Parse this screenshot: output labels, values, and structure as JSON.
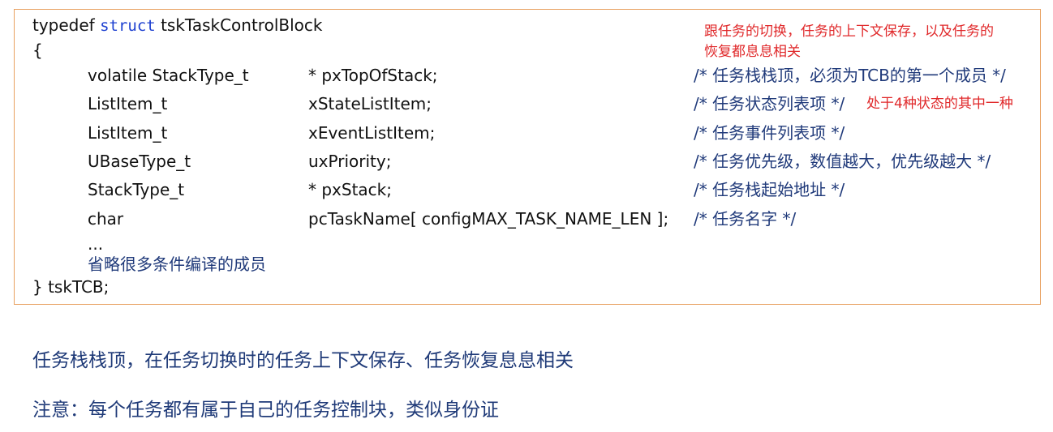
{
  "code": {
    "typedef_prefix": "typedef ",
    "keyword": "struct",
    "struct_name": " tskTaskControlBlock",
    "open_brace": "{",
    "members": [
      {
        "type": "volatile StackType_t",
        "name": "* pxTopOfStack;",
        "comment": "/* 任务栈栈顶，必须为TCB的第一个成员 */"
      },
      {
        "type": "ListItem_t",
        "name": "xStateListItem;",
        "comment": "/* 任务状态列表项 */"
      },
      {
        "type": "ListItem_t",
        "name": "xEventListItem;",
        "comment": "/* 任务事件列表项 */"
      },
      {
        "type": "UBaseType_t",
        "name": "uxPriority;",
        "comment": "/* 任务优先级，数值越大，优先级越大 */"
      },
      {
        "type": "StackType_t",
        "name": "* pxStack;",
        "comment": "/* 任务栈起始地址 */"
      },
      {
        "type": "char",
        "name": "pcTaskName[ configMAX_TASK_NAME_LEN ];",
        "comment": "/* 任务名字 */"
      }
    ],
    "ellipsis": "...",
    "omitted_note": "省略很多条件编译的成员",
    "close_line": "} tskTCB;"
  },
  "annotations": {
    "switch_note_line1": "跟任务的切换，任务的上下文保存，以及任务的",
    "switch_note_line2": "恢复都息息相关",
    "state_note": "处于4种状态的其中一种"
  },
  "notes": {
    "line1": "任务栈栈顶，在任务切换时的任务上下文保存、任务恢复息息相关",
    "line2": "注意：每个任务都有属于自己的任务控制块，类似身份证"
  },
  "colors": {
    "border": "#e8a060",
    "keyword": "#1c3fd0",
    "comment": "#203a7a",
    "annotation": "#e0282a"
  }
}
